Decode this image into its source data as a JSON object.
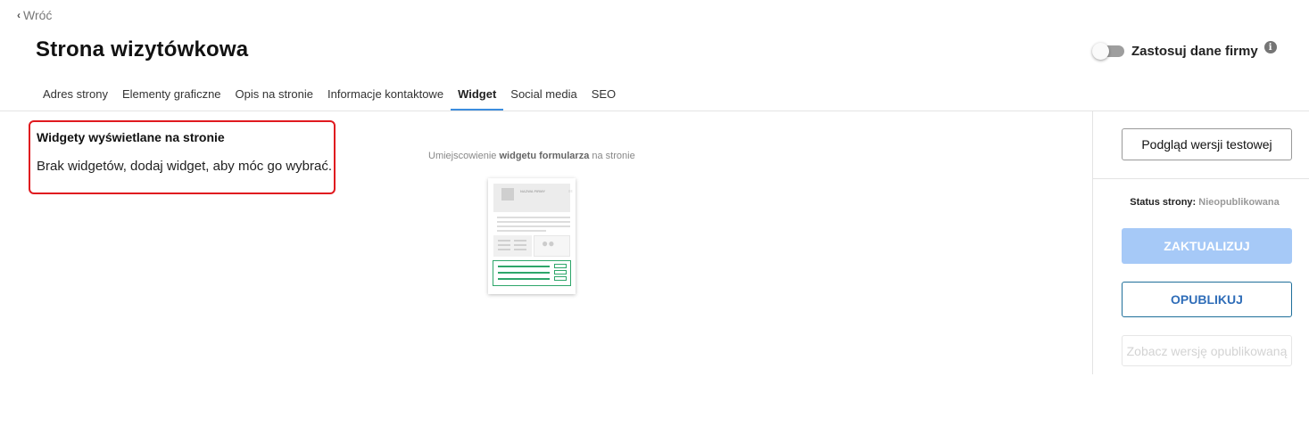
{
  "nav": {
    "back_icon": "chevron-left-icon",
    "back_label": "Wróć"
  },
  "header": {
    "title": "Strona wizytówkowa",
    "toggle_label": "Zastosuj dane firmy",
    "toggle_on": false,
    "info_glyph": "i"
  },
  "tabs": [
    {
      "label": "Adres strony",
      "active": false
    },
    {
      "label": "Elementy graficzne",
      "active": false
    },
    {
      "label": "Opis na stronie",
      "active": false
    },
    {
      "label": "Informacje kontaktowe",
      "active": false
    },
    {
      "label": "Widget",
      "active": true
    },
    {
      "label": "Social media",
      "active": false
    },
    {
      "label": "SEO",
      "active": false
    }
  ],
  "widgets": {
    "title": "Widgety wyświetlane na stronie",
    "empty_message": "Brak widgetów, dodaj widget, aby móc go wybrać."
  },
  "placement": {
    "caption_prefix": "Umiejscowienie ",
    "caption_bold": "widgetu formularza",
    "caption_suffix": " na stronie",
    "preview_name": "NAZWA FIRMY",
    "preview_dots": "≡≡",
    "highlight_color": "#2ea66a"
  },
  "sidebar": {
    "preview_button": "Podgląd wersji testowej",
    "status_label": "Status strony: ",
    "status_value": "Nieopublikowana",
    "update_button": "ZAKTUALIZUJ",
    "publish_button": "OPUBLIKUJ",
    "view_published_button": "Zobacz wersję opublikowaną"
  },
  "colors": {
    "accent": "#3c8dde",
    "highlight_border": "#e0191f",
    "update_disabled": "#a6c9f7",
    "publish_text": "#2f6db8"
  }
}
